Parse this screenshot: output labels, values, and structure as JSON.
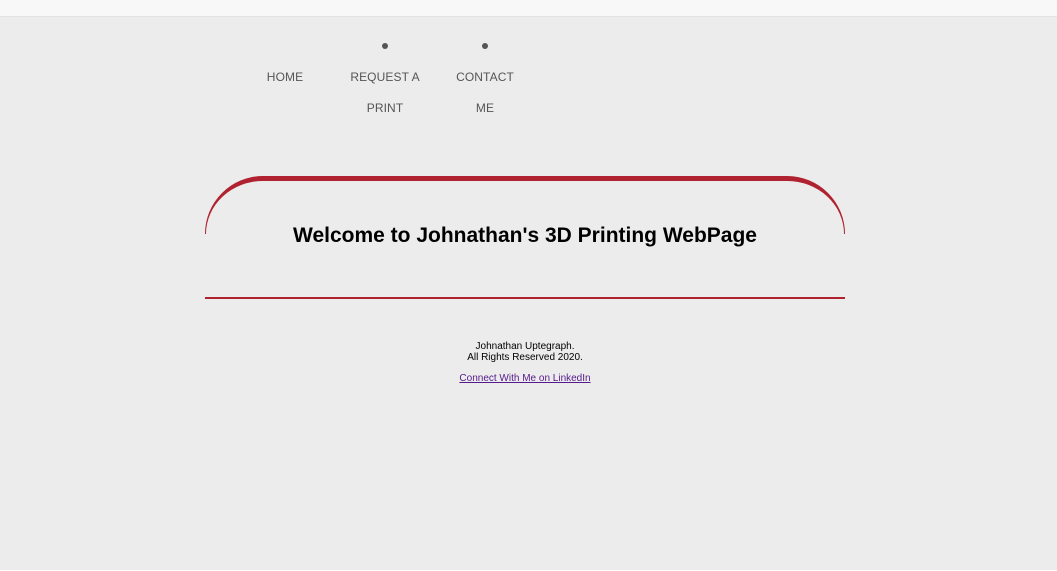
{
  "nav": {
    "items": [
      {
        "line1": "HOME",
        "line2": ""
      },
      {
        "line1": "REQUEST A",
        "line2": "PRINT"
      },
      {
        "line1": "CONTACT",
        "line2": "ME"
      }
    ]
  },
  "banner": {
    "title": "Welcome to Johnathan's 3D Printing WebPage",
    "accent_color": "#b0222f"
  },
  "footer": {
    "name_line": "Johnathan Uptegraph.",
    "rights_line": "All Rights Reserved 2020.",
    "link_text": "Connect With Me on LinkedIn"
  }
}
